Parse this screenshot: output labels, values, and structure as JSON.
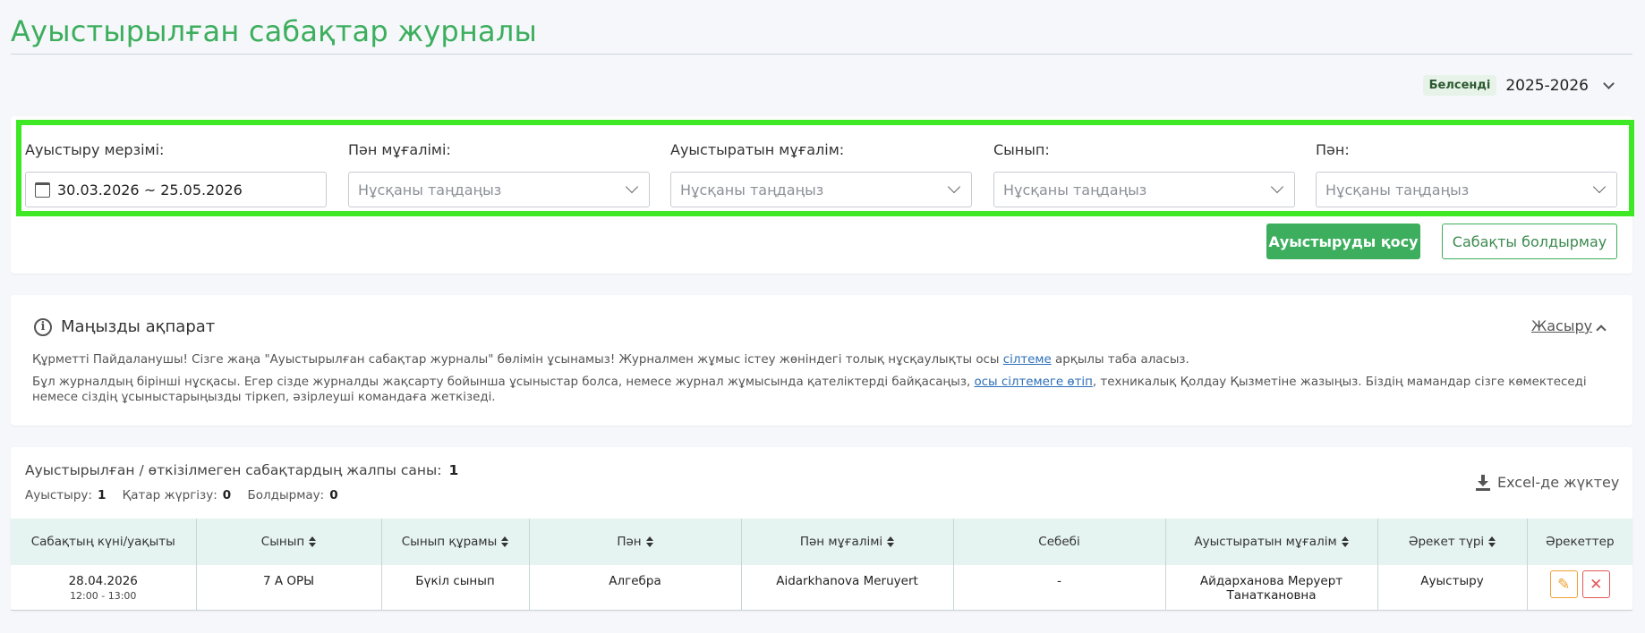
{
  "page": {
    "title": "Ауыстырылған сабақтар журналы"
  },
  "year_selector": {
    "badge": "Белсенді",
    "value": "2025-2026"
  },
  "filters": {
    "date": {
      "label": "Ауыстыру мерзімі:",
      "value": "30.03.2026 ~ 25.05.2026"
    },
    "subject_teacher": {
      "label": "Пән мұғалімі:",
      "placeholder": "Нұсқаны таңдаңыз"
    },
    "replacing_teacher": {
      "label": "Ауыстыратын мұғалім:",
      "placeholder": "Нұсқаны таңдаңыз"
    },
    "class": {
      "label": "Сынып:",
      "placeholder": "Нұсқаны таңдаңыз"
    },
    "subject": {
      "label": "Пән:",
      "placeholder": "Нұсқаны таңдаңыз"
    }
  },
  "buttons": {
    "add_replacement": "Ауыстыруды қосу",
    "cancel_lesson": "Сабақты болдырмау"
  },
  "info": {
    "title": "Маңызды ақпарат",
    "hide_label": "Жасыру",
    "p1_before": "Құрметті Пайдаланушы! Сізге жаңа \"Ауыстырылған сабақтар журналы\" бөлімін ұсынамыз! Журналмен жұмыс істеу жөніндегі толық нұсқаулықты осы ",
    "p1_link": "сілтеме",
    "p1_after": " арқылы таба аласыз.",
    "p2_before": "Бұл журналдың бірінші нұсқасы. Егер сізде журналды жақсарту бойынша ұсыныстар болса, немесе журнал жұмысында қателіктерді байқасаңыз, ",
    "p2_link": "осы сілтемеге өтіп",
    "p2_after": ", техникалық Қолдау Қызметіне жазыңыз. Біздің мамандар сізге көмектеседі немесе сіздің ұсыныстарыңызды тіркеп, әзірлеуші командаға жеткізеді."
  },
  "summary": {
    "total_label": "Ауыстырылған / өткізілмеген сабақтардың жалпы саны:",
    "total_value": "1",
    "replacement_label": "Ауыстыру:",
    "replacement_value": "1",
    "parallel_label": "Қатар жүргізу:",
    "parallel_value": "0",
    "cancel_label": "Болдырмау:",
    "cancel_value": "0",
    "excel_label": "Excel-де жүктеу"
  },
  "table": {
    "headers": [
      "Сабақтың күні/уақыты",
      "Сынып",
      "Сынып құрамы",
      "Пән",
      "Пән мұғалімі",
      "Себебі",
      "Ауыстыратын мұғалім",
      "Әрекет түрі",
      "Әрекеттер"
    ],
    "rows": [
      {
        "date": "28.04.2026",
        "time": "12:00 - 13:00",
        "class": "7 А ОРЫ",
        "composition": "Бүкіл сынып",
        "subject": "Алгебра",
        "teacher": "Aidarkhanova Meruyert",
        "reason": "-",
        "replacing_teacher_line1": "Айдарханова Меруерт",
        "replacing_teacher_line2": "Танаткановна",
        "action_type": "Ауыстыру"
      }
    ]
  },
  "colors": {
    "brand_green": "#3cae5d",
    "highlight": "#3ee824",
    "header_bg": "#e5f3f1",
    "edit": "#f0a030",
    "delete": "#e05757"
  }
}
